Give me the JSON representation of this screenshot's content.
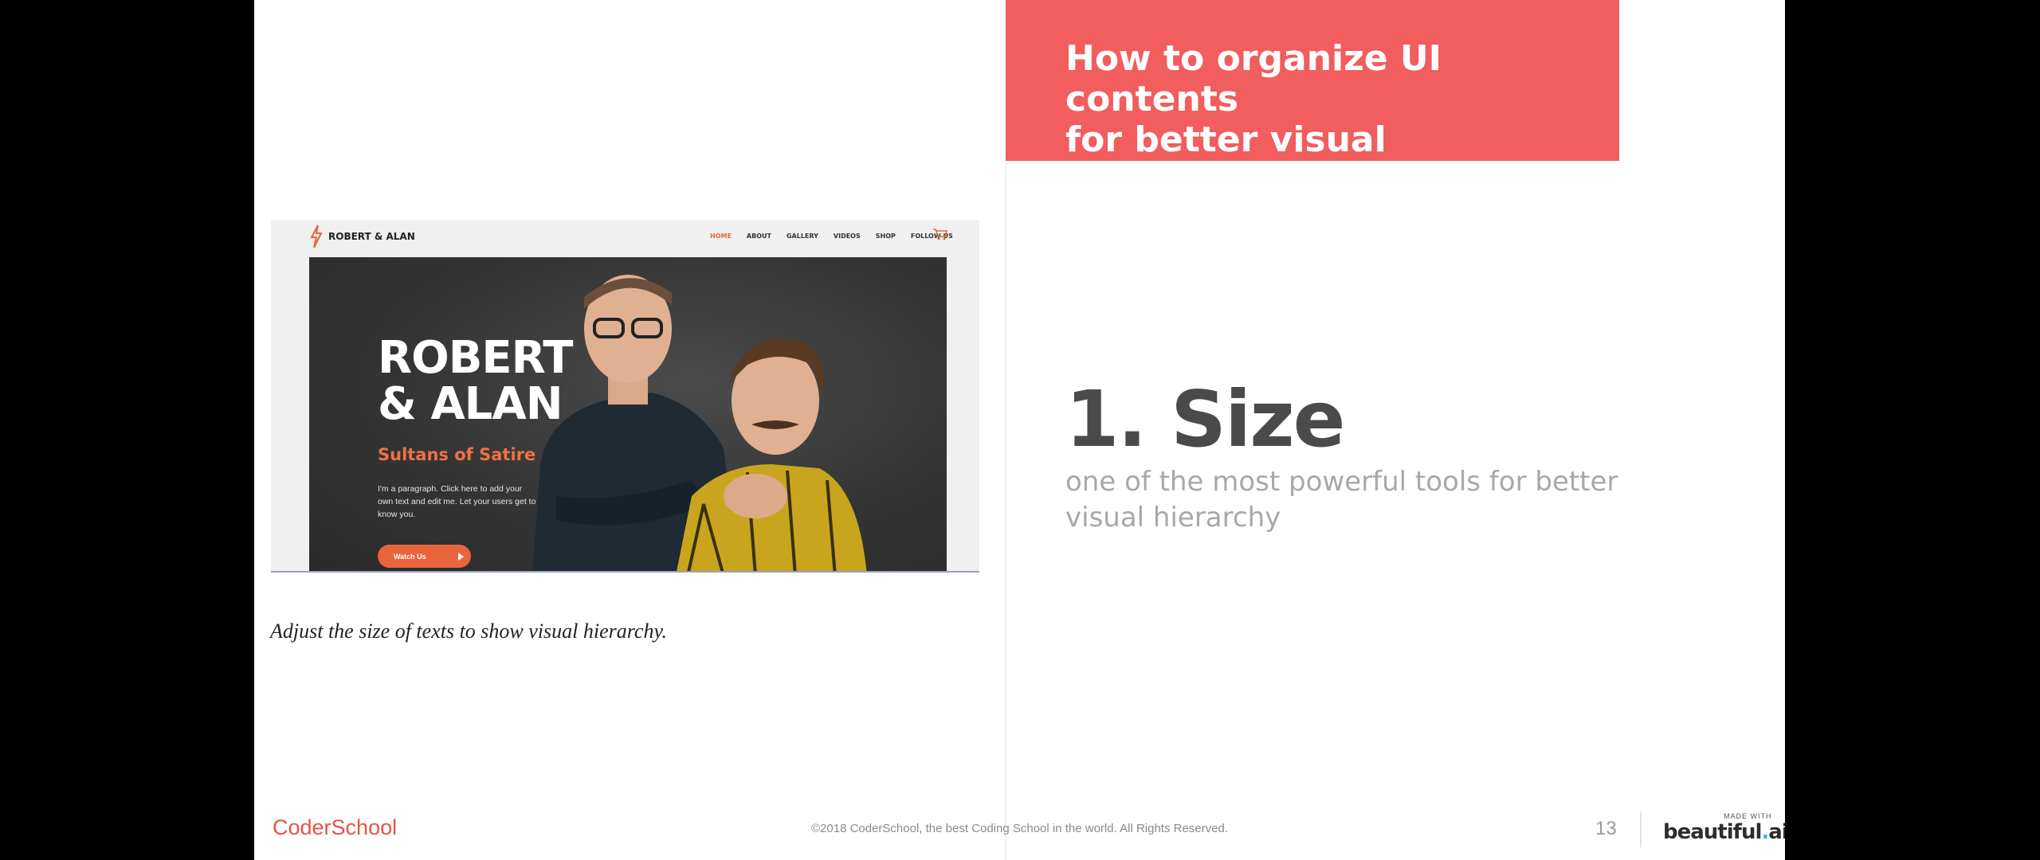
{
  "header": {
    "title": "How to organize UI contents\nfor better visual hierarchy?",
    "accent_color": "#f25d5d"
  },
  "screenshot": {
    "brand": "ROBERT & ALAN",
    "menu": [
      "HOME",
      "ABOUT",
      "GALLERY",
      "VIDEOS",
      "SHOP",
      "FOLLOW US"
    ],
    "hero_title": "ROBERT\n& ALAN",
    "hero_subtitle": "Sultans of Satire",
    "hero_paragraph": "I'm a paragraph. Click here to add your own text and edit me. Let your users get to know you.",
    "button_label": "Watch Us",
    "accent_color": "#e8643d"
  },
  "caption": "Adjust the size of texts to show visual hierarchy.",
  "main": {
    "heading": "1. Size",
    "subtext": "one of the most powerful tools for better visual hierarchy"
  },
  "footer": {
    "logo": "CoderSchool",
    "copyright": "©2018 CoderSchool, the best Coding School in the world. All Rights Reserved.",
    "page_number": "13",
    "made_with": "MADE WITH",
    "brand_left": "beautiful",
    "brand_dot": ".",
    "brand_right": "ai"
  }
}
